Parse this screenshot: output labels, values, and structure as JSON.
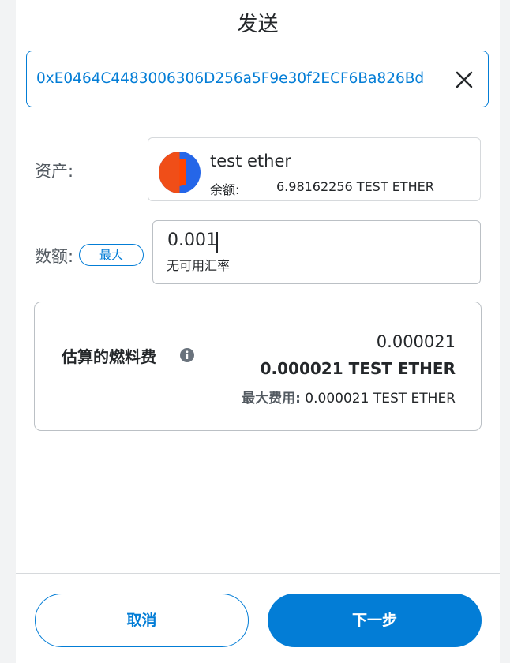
{
  "header": {
    "title": "发送"
  },
  "recipient": {
    "address": "0xE0464C4483006306D256a5F9e30f2ECF6Ba826Bd",
    "clear_icon": "close-icon"
  },
  "asset": {
    "label": "资产:",
    "name": "test ether",
    "balance_label": "余额:",
    "balance_value": "6.98162256 TEST ETHER",
    "logo_icon": "token-logo-icon"
  },
  "amount": {
    "label": "数额:",
    "max_label": "最大",
    "value": "0.001",
    "rate_text": "无可用汇率"
  },
  "gas": {
    "label": "估算的燃料费",
    "info_icon": "info-icon",
    "value_primary": "0.000021",
    "value_secondary": "0.000021 TEST ETHER",
    "max_fee_label": "最大费用:",
    "max_fee_value": " 0.000021 TEST ETHER"
  },
  "footer": {
    "cancel_label": "取消",
    "next_label": "下一步"
  },
  "colors": {
    "accent": "#037dd6",
    "text": "#24272a",
    "muted": "#535a61"
  }
}
